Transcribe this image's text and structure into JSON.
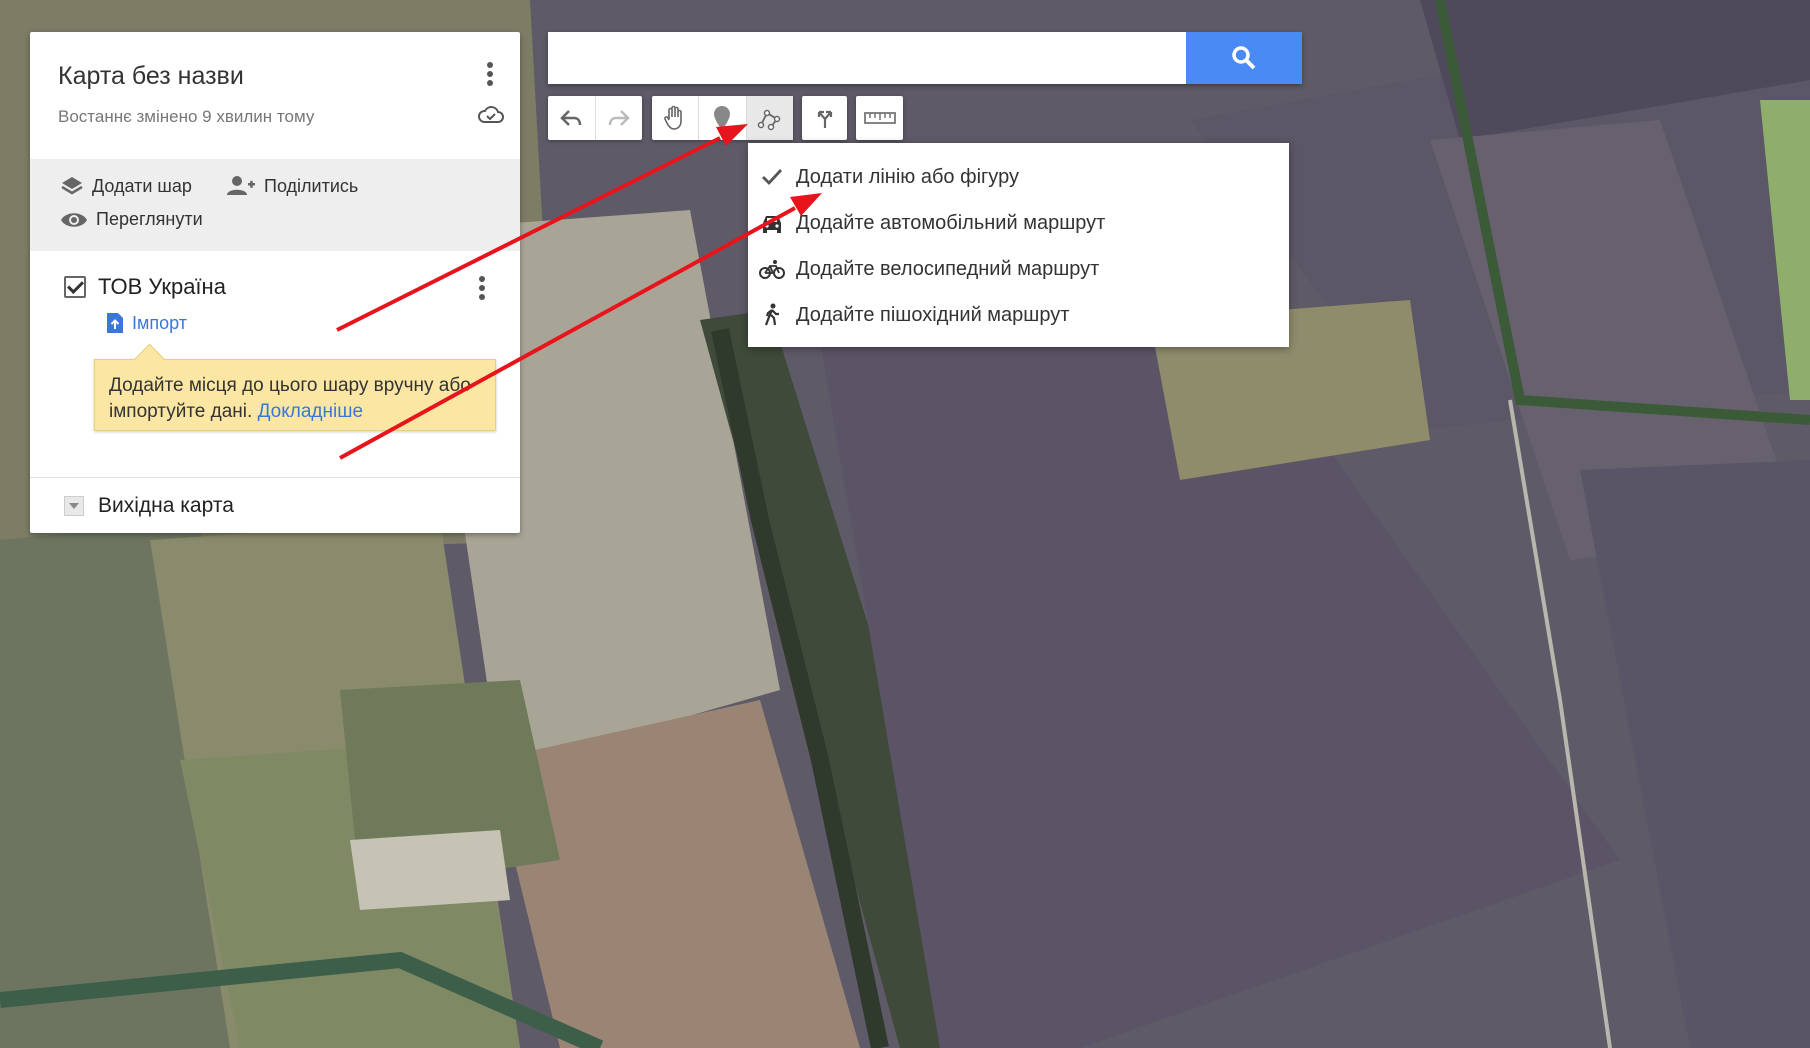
{
  "map_panel": {
    "title": "Карта без назви",
    "subtitle": "Востаннє змінено 9 хвилин тому",
    "actions": {
      "add_layer": "Додати шар",
      "share": "Поділитись",
      "preview": "Переглянути"
    },
    "layer": {
      "name": "ТОВ Україна",
      "checked": true,
      "import_label": "Імпорт",
      "tip_text": "Додайте місця до цього шару вручну або імпортуйте дані.",
      "tip_link": "Докладніше"
    },
    "base_map_label": "Вихідна карта"
  },
  "search": {
    "value": "",
    "placeholder": ""
  },
  "toolbar": {
    "icons": [
      "undo-icon",
      "redo-icon",
      "hand-icon",
      "marker-icon",
      "draw-line-icon",
      "directions-icon",
      "ruler-icon"
    ],
    "active": "draw-line-icon"
  },
  "draw_menu": {
    "items": [
      {
        "label": "Додати лінію або фігуру",
        "icon": "check-icon",
        "selected": true
      },
      {
        "label": "Додайте автомобільний маршрут",
        "icon": "car-icon"
      },
      {
        "label": "Додайте велосипедний маршрут",
        "icon": "bike-icon"
      },
      {
        "label": "Додайте пішохідний маршрут",
        "icon": "walk-icon"
      }
    ]
  },
  "colors": {
    "accent_blue": "#4a8af4",
    "link_blue": "#3a78d8",
    "tip_bg": "#fbe6a4",
    "annotation_red": "#e8141c"
  }
}
